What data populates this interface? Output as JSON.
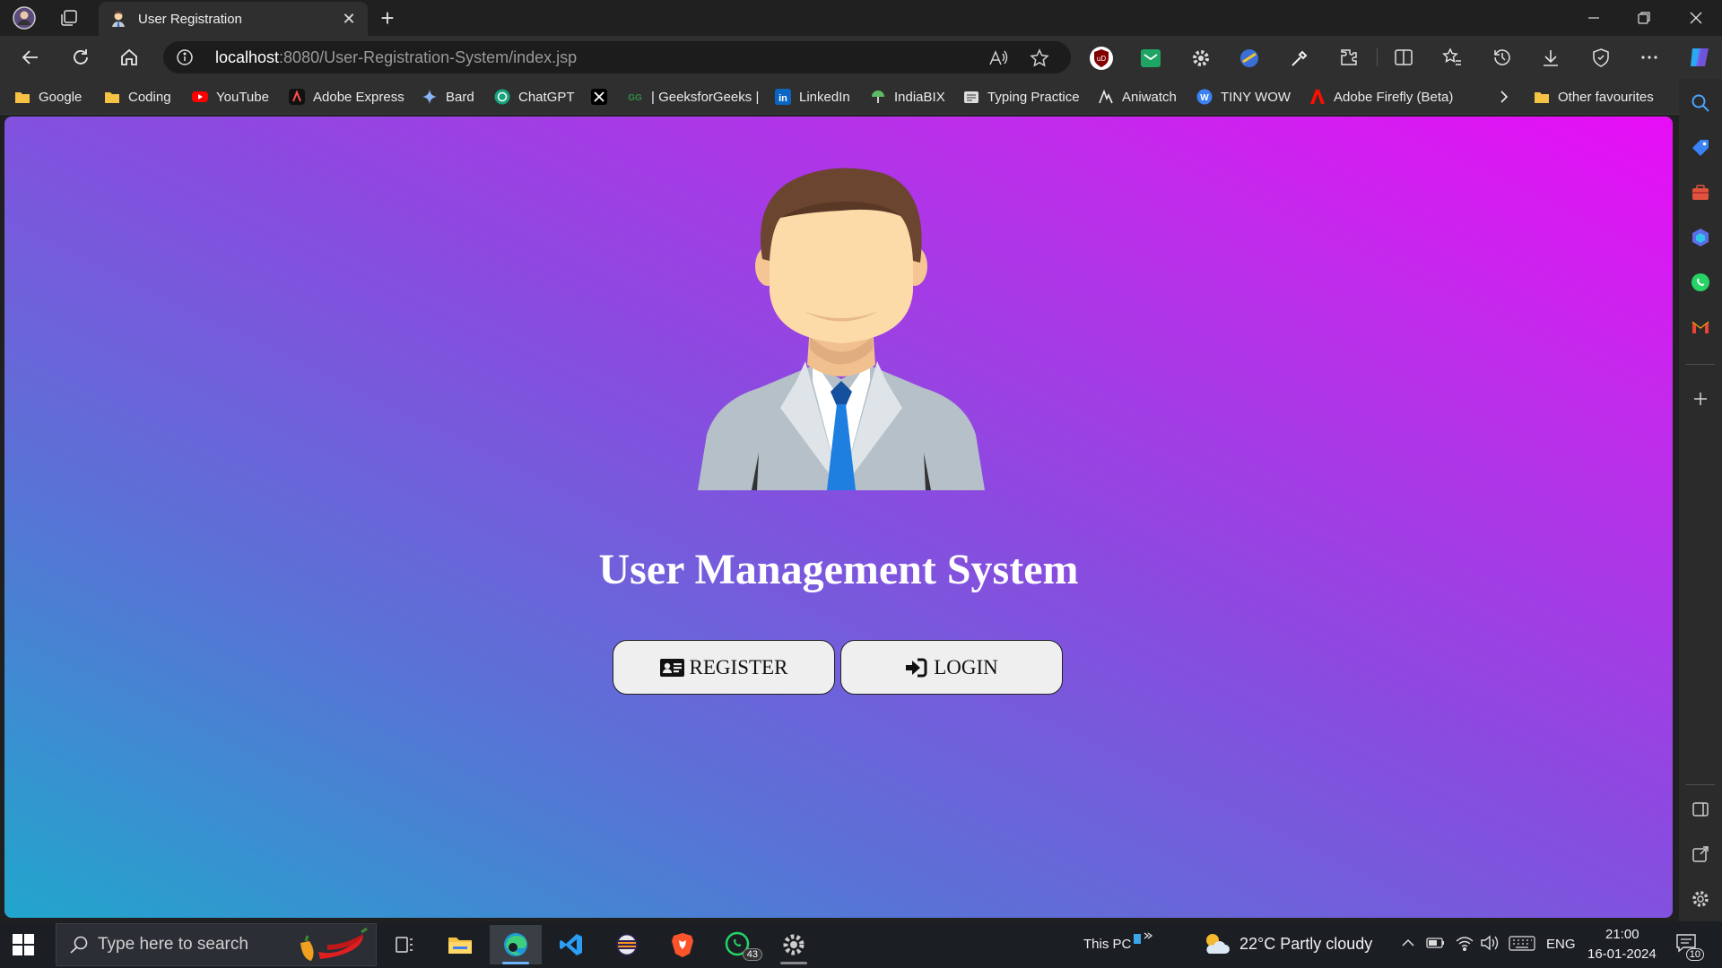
{
  "browser": {
    "tab_title": "User Registration",
    "url_host": "localhost",
    "url_path": ":8080/User-Registration-System/index.jsp"
  },
  "favourites": [
    {
      "label": "Google",
      "icon": "folder-icon"
    },
    {
      "label": "Coding",
      "icon": "folder-icon"
    },
    {
      "label": "YouTube",
      "icon": "youtube-icon"
    },
    {
      "label": "Adobe Express",
      "icon": "adobe-express-icon"
    },
    {
      "label": "Bard",
      "icon": "bard-icon"
    },
    {
      "label": "ChatGPT",
      "icon": "chatgpt-icon"
    },
    {
      "label": "",
      "icon": "x-icon"
    },
    {
      "label": "| GeeksforGeeks |",
      "icon": "gfg-icon"
    },
    {
      "label": "LinkedIn",
      "icon": "linkedin-icon"
    },
    {
      "label": "IndiaBIX",
      "icon": "indiabix-icon"
    },
    {
      "label": "Typing Practice",
      "icon": "typing-icon"
    },
    {
      "label": "Aniwatch",
      "icon": "aniwatch-icon"
    },
    {
      "label": "TINY WOW",
      "icon": "tinywow-icon"
    },
    {
      "label": "Adobe Firefly (Beta)",
      "icon": "adobe-icon"
    }
  ],
  "other_favourites": "Other favourites",
  "page": {
    "heading": "User Management System",
    "register_label": "REGISTER",
    "login_label": "LOGIN"
  },
  "taskbar": {
    "search_placeholder": "Type here to search",
    "whatsapp_badge": "43",
    "this_pc": "This PC",
    "weather": "22°C  Partly cloudy",
    "language": "ENG",
    "time": "21:00",
    "date": "16-01-2024",
    "notifications": "10"
  },
  "colors": {
    "gradient_start": "#21a6cc",
    "gradient_end": "#e80df6",
    "button_bg": "#efefef"
  }
}
